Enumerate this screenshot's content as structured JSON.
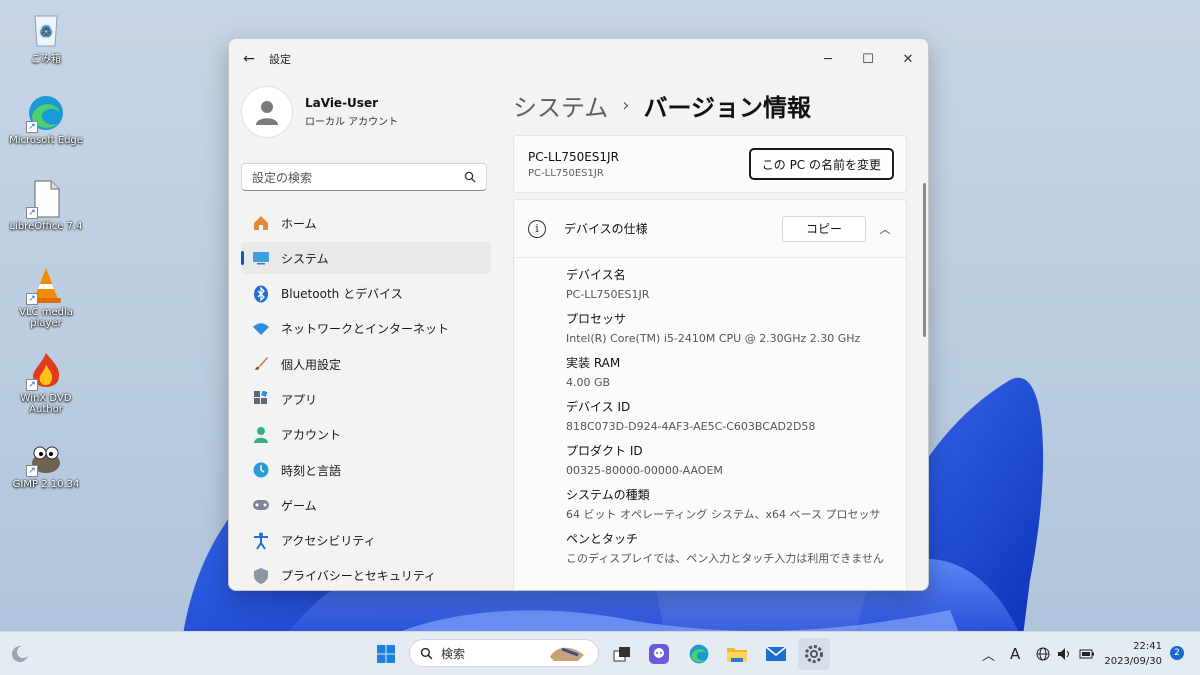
{
  "desktop": {
    "icons": [
      {
        "name": "recycle-bin",
        "label": "ごみ箱"
      },
      {
        "name": "microsoft-edge",
        "label": "Microsoft Edge"
      },
      {
        "name": "libreoffice",
        "label": "LibreOffice 7.4"
      },
      {
        "name": "vlc",
        "label": "VLC media player"
      },
      {
        "name": "winx-dvd-author",
        "label": "WinX DVD Author"
      },
      {
        "name": "gimp",
        "label": "GIMP 2.10.34"
      }
    ]
  },
  "window": {
    "title": "設定",
    "back_icon": "back-arrow-icon",
    "controls": {
      "minimize": "─",
      "maximize": "☐",
      "close": "✕"
    }
  },
  "sidebar": {
    "user_name": "LaVie-User",
    "user_sub": "ローカル アカウント",
    "search_placeholder": "設定の検索",
    "items": [
      {
        "label": "ホーム",
        "icon": "home-icon",
        "active": false
      },
      {
        "label": "システム",
        "icon": "system-icon",
        "active": true
      },
      {
        "label": "Bluetooth とデバイス",
        "icon": "bluetooth-icon",
        "active": false
      },
      {
        "label": "ネットワークとインターネット",
        "icon": "wifi-icon",
        "active": false
      },
      {
        "label": "個人用設定",
        "icon": "brush-icon",
        "active": false
      },
      {
        "label": "アプリ",
        "icon": "apps-icon",
        "active": false
      },
      {
        "label": "アカウント",
        "icon": "account-icon",
        "active": false
      },
      {
        "label": "時刻と言語",
        "icon": "clock-globe-icon",
        "active": false
      },
      {
        "label": "ゲーム",
        "icon": "gamepad-icon",
        "active": false
      },
      {
        "label": "アクセシビリティ",
        "icon": "accessibility-icon",
        "active": false
      },
      {
        "label": "プライバシーとセキュリティ",
        "icon": "shield-icon",
        "active": false
      }
    ]
  },
  "main": {
    "breadcrumb_parent": "システム",
    "breadcrumb_sep": "›",
    "breadcrumb_current": "バージョン情報",
    "pc_name": "PC-LL750ES1JR",
    "pc_sub": "PC-LL750ES1JR",
    "rename_button": "この PC の名前を変更",
    "spec_title": "デバイスの仕様",
    "copy_button": "コピー",
    "specs": [
      {
        "label": "デバイス名",
        "value": "PC-LL750ES1JR"
      },
      {
        "label": "プロセッサ",
        "value": "Intel(R) Core(TM) i5-2410M CPU @ 2.30GHz   2.30 GHz"
      },
      {
        "label": "実装 RAM",
        "value": "4.00 GB"
      },
      {
        "label": "デバイス ID",
        "value": "818C073D-D924-4AF3-AE5C-C603BCAD2D58"
      },
      {
        "label": "プロダクト ID",
        "value": "00325-80000-00000-AAOEM"
      },
      {
        "label": "システムの種類",
        "value": "64 ビット オペレーティング システム、x64 ベース プロセッサ"
      },
      {
        "label": "ペンとタッチ",
        "value": "このディスプレイでは、ペン入力とタッチ入力は利用できません"
      }
    ]
  },
  "taskbar": {
    "search_placeholder": "検索",
    "time": "22:41",
    "date": "2023/09/30",
    "notification_count": "2",
    "ime": "A"
  }
}
